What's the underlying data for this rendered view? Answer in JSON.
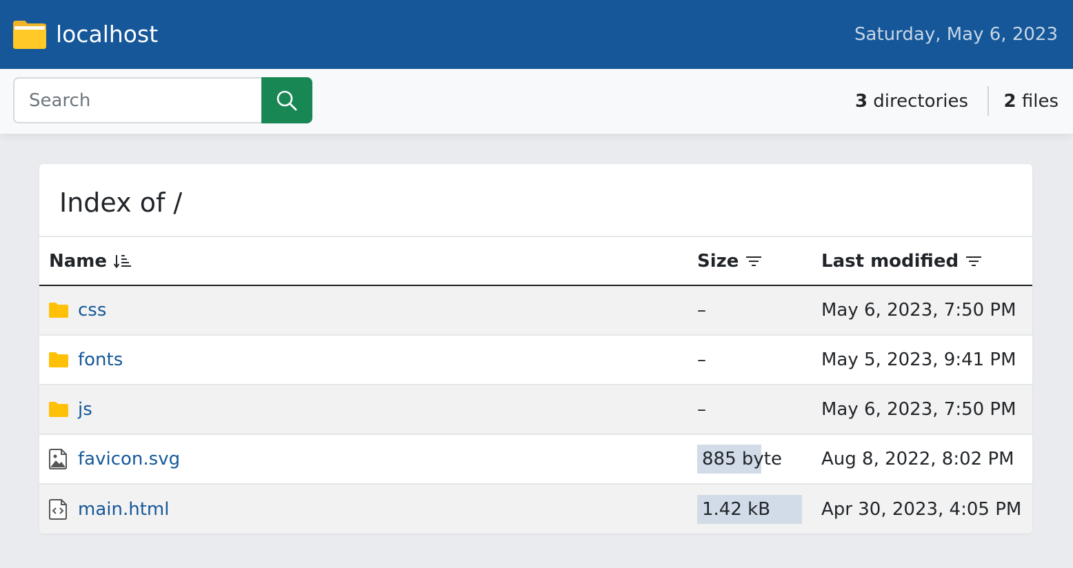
{
  "header": {
    "title": "localhost",
    "date": "Saturday, May 6, 2023"
  },
  "toolbar": {
    "search_placeholder": "Search",
    "directories_count": "3",
    "directories_label": "directories",
    "files_count": "2",
    "files_label": "files"
  },
  "main": {
    "title": "Index of /",
    "columns": {
      "name": "Name",
      "size": "Size",
      "modified": "Last modified"
    },
    "rows": [
      {
        "name": "css",
        "type": "folder",
        "size": "–",
        "size_fraction": 0,
        "modified": "May 6, 2023, 7:50 PM"
      },
      {
        "name": "fonts",
        "type": "folder",
        "size": "–",
        "size_fraction": 0,
        "modified": "May 5, 2023, 9:41 PM"
      },
      {
        "name": "js",
        "type": "folder",
        "size": "–",
        "size_fraction": 0,
        "modified": "May 6, 2023, 7:50 PM"
      },
      {
        "name": "favicon.svg",
        "type": "image-file",
        "size": "885 byte",
        "size_fraction": 0.61,
        "modified": "Aug 8, 2022, 8:02 PM"
      },
      {
        "name": "main.html",
        "type": "code-file",
        "size": "1.42 kB",
        "size_fraction": 1.0,
        "modified": "Apr 30, 2023, 4:05 PM"
      }
    ]
  },
  "colors": {
    "header_bg": "#155799",
    "search_button": "#198754",
    "folder_icon": "#ffc107",
    "link": "#155799",
    "size_bar": "#d1dce8"
  }
}
